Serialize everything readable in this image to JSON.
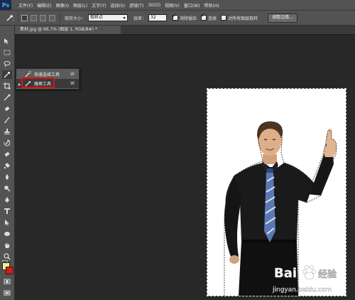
{
  "app": {
    "logo": "Ps"
  },
  "menu": [
    "文件(F)",
    "编辑(E)",
    "图像(I)",
    "图层(L)",
    "文字(Y)",
    "选择(S)",
    "滤镜(T)",
    "3D(D)",
    "视图(V)",
    "窗口(W)",
    "帮助(H)"
  ],
  "options": {
    "sample_size_label": "取样大小：",
    "sample_size_value": "取样点",
    "tolerance_label": "容差：",
    "tolerance_value": "32",
    "antialias_label": "消除锯齿",
    "contiguous_label": "连续",
    "sample_all_label": "对所有图层取样",
    "refine_edge_label": "调整边缘..."
  },
  "document": {
    "tab_title": "素材.jpg @ 66.7% (图层 1, RGB/8#) *"
  },
  "flyout": {
    "items": [
      {
        "label": "快速选择工具",
        "shortcut": "W",
        "icon": "quick-selection-icon"
      },
      {
        "label": "魔棒工具",
        "shortcut": "W",
        "icon": "magic-wand-icon"
      }
    ]
  },
  "colors": {
    "foreground": "#f3ee8c",
    "background": "#e01616",
    "highlight_box": "#e01010"
  },
  "watermark": {
    "brand": "Bai",
    "brand2": "经验",
    "url": "jingyan.baidu.com"
  }
}
